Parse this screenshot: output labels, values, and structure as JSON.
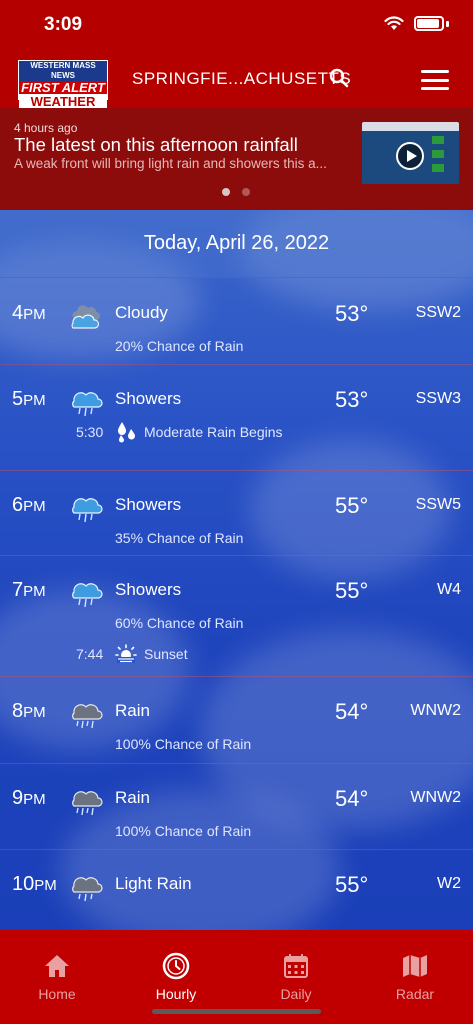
{
  "status_bar": {
    "time": "3:09"
  },
  "header": {
    "logo": {
      "line1": "WESTERN MASS NEWS",
      "line2": "FIRST ALERT",
      "line3": "WEATHER"
    },
    "location": "SPRINGFIE...ACHUSETTS"
  },
  "news": {
    "age": "4 hours ago",
    "title": "The latest on this afternoon rainfall",
    "summary": "A weak front will bring light rain and showers this a..."
  },
  "date_label": "Today, April 26, 2022",
  "hourly": [
    {
      "hour": "4",
      "ampm": "PM",
      "icon": "cloudy-icon",
      "condition": "Cloudy",
      "temp": "53°",
      "wind": "SSW2",
      "chance": "20% Chance of Rain"
    },
    {
      "hour": "5",
      "ampm": "PM",
      "icon": "showers-icon",
      "condition": "Showers",
      "temp": "53°",
      "wind": "SSW3",
      "event_time": "5:30",
      "event_icon": "raindrops-icon",
      "event_label": "Moderate Rain Begins"
    },
    {
      "hour": "6",
      "ampm": "PM",
      "icon": "showers-icon",
      "condition": "Showers",
      "temp": "55°",
      "wind": "SSW5",
      "chance": "35% Chance of Rain"
    },
    {
      "hour": "7",
      "ampm": "PM",
      "icon": "showers-icon",
      "condition": "Showers",
      "temp": "55°",
      "wind": "W4",
      "chance": "60% Chance of Rain",
      "event_time": "7:44",
      "event_icon": "sunset-icon",
      "event_label": "Sunset"
    },
    {
      "hour": "8",
      "ampm": "PM",
      "icon": "rain-icon",
      "condition": "Rain",
      "temp": "54°",
      "wind": "WNW2",
      "chance": "100% Chance of Rain"
    },
    {
      "hour": "9",
      "ampm": "PM",
      "icon": "rain-icon",
      "condition": "Rain",
      "temp": "54°",
      "wind": "WNW2",
      "chance": "100% Chance of Rain"
    },
    {
      "hour": "10",
      "ampm": "PM",
      "icon": "rain-icon",
      "condition": "Light Rain",
      "temp": "55°",
      "wind": "W2"
    }
  ],
  "nav": [
    {
      "label": "Home",
      "icon": "home-icon"
    },
    {
      "label": "Hourly",
      "icon": "clock-icon",
      "active": true
    },
    {
      "label": "Daily",
      "icon": "calendar-icon"
    },
    {
      "label": "Radar",
      "icon": "map-icon"
    }
  ],
  "colors": {
    "brand_red": "#b50000",
    "news_bg": "#8c0b0b",
    "sky_blue": "#1a3fb8"
  }
}
